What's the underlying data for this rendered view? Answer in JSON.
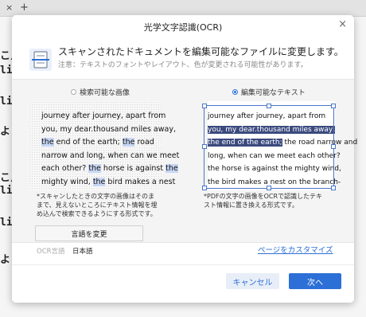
{
  "background": {
    "tab_close": "×",
    "tab_add": "+",
    "lines": [
      "こ/",
      "lis",
      "lis",
      "よ ?",
      "こ/",
      "lis&",
      "lisz",
      "よ ?"
    ]
  },
  "dialog": {
    "title": "光学文字認識(OCR)",
    "close": "×",
    "heading": "スキャンされたドキュメントを編集可能なファイルに変更します。",
    "note": "注意：テキストのフォントやレイアウト、色が変更される可能性があります。",
    "options": [
      {
        "label": "検索可能な画像",
        "selected": false
      },
      {
        "label": "編集可能なテキスト",
        "selected": true
      }
    ],
    "left_preview": {
      "line1": "journey after journey, apart from",
      "line2": "you, my dear.thousand miles away,",
      "l3a": "the",
      "l3b": " end of the earth; ",
      "l3c": "the",
      "l3d": " road",
      "line4": "narrow and long, when can we meet",
      "l5a": "each other? ",
      "l5b": "the",
      "l5c": " horse is against ",
      "l5d": "the",
      "l6a": "mighty wind, ",
      "l6b": "the",
      "l6c": " bird makes a nest"
    },
    "right_preview": {
      "line1": "journey after journey, apart from",
      "line2": "you, my dear.thousand miles away,",
      "line3": "the end of the earth;",
      "line3_rest": " the road narrow and",
      "line4": "long, when can we meet each other?",
      "line5": "the horse is against the mighty wind,",
      "line6": "the bird makes a nest on the branch-"
    },
    "left_desc": [
      "*スキャンしたときの文字の画像はそのま",
      "まで、見えないところにテキスト情報を埋",
      "め込んで検索できるようにする形式です。"
    ],
    "right_desc": [
      "*PDFの文字の画像をOCRで認識したテキ",
      "スト情報に置き換える形式です。"
    ],
    "language_button": "言語を変更",
    "ocr_language_label": "OCR言語",
    "ocr_language_value": "日本語",
    "customize_link": "ページをカスタマイズ",
    "cancel_button": "キャンセル",
    "next_button": "次へ",
    "accent_color": "#2c6fd6"
  }
}
